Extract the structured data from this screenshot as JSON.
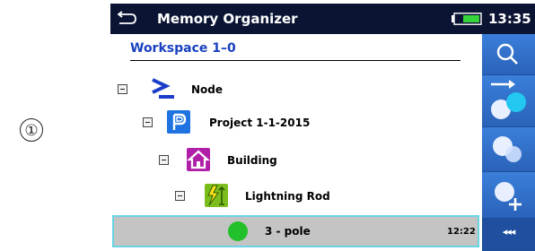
{
  "callout": "①",
  "header": {
    "title": "Memory Organizer",
    "time": "13:35"
  },
  "workspace": {
    "label": "Workspace 1–0"
  },
  "tree": {
    "node": {
      "label": "Node"
    },
    "project": {
      "label": "Project 1-1-2015"
    },
    "building": {
      "label": "Building"
    },
    "lightning": {
      "label": "Lightning Rod"
    },
    "selected": {
      "label": "3 - pole",
      "time": "12:22",
      "status_color": "#22c02a"
    }
  },
  "sidebar": {
    "buttons": [
      "search-icon",
      "recall-move-icon",
      "objects-icon",
      "add-object-icon",
      "more-icon"
    ],
    "more_label": "◂◂◂"
  },
  "colors": {
    "titlebar": "#0b1433",
    "sidebar": "#2e6ec8",
    "workspace_text": "#1840c0",
    "selection_bg": "#c4c4c4",
    "selection_border": "#6ad3e6"
  }
}
